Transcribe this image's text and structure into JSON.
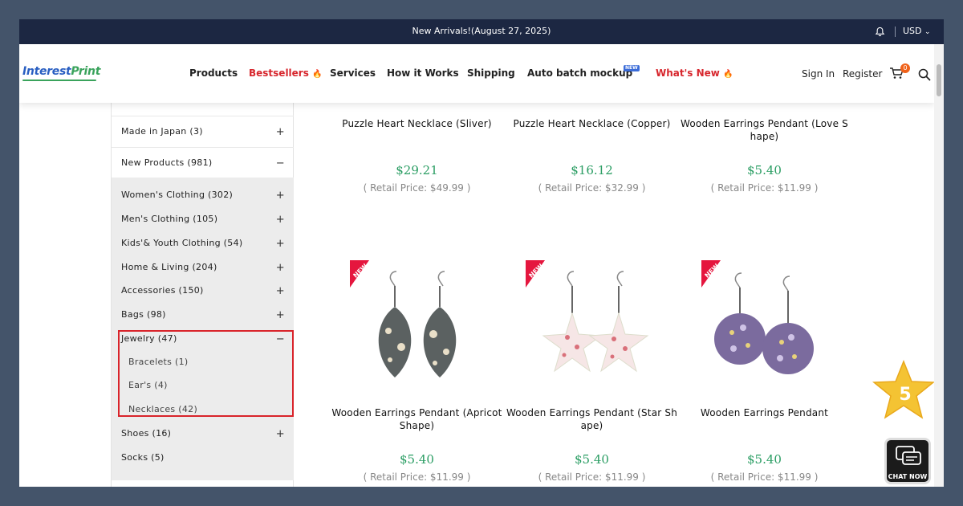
{
  "announcement": {
    "text": "New Arrivals!(August 27, 2025)",
    "currency": "USD"
  },
  "logo": {
    "part1": "Interest",
    "part2": "Print"
  },
  "nav": {
    "products": "Products",
    "bestsellers": "Bestsellers",
    "services": "Services",
    "how_it_works": "How it Works",
    "shipping": "Shipping",
    "auto_batch": "Auto batch mockup",
    "auto_batch_badge": "NEW",
    "whats_new": "What's New",
    "sign_in": "Sign In",
    "register": "Register",
    "cart_count": "0"
  },
  "sidebar": {
    "made_in_japan": "Made in Japan  (3)",
    "new_products": "New Products  (981)",
    "plus": "+",
    "minus": "−",
    "categories": [
      {
        "label": "Women's Clothing  (302)",
        "sign": "+"
      },
      {
        "label": "Men's Clothing  (105)",
        "sign": "+"
      },
      {
        "label": "Kids'& Youth Clothing  (54)",
        "sign": "+"
      },
      {
        "label": "Home & Living  (204)",
        "sign": "+"
      },
      {
        "label": "Accessories  (150)",
        "sign": "+"
      },
      {
        "label": "Bags  (98)",
        "sign": "+"
      },
      {
        "label": "Jewelry  (47)",
        "sign": "−"
      },
      {
        "label": "Shoes  (16)",
        "sign": "+"
      },
      {
        "label": "Socks  (5)",
        "sign": ""
      }
    ],
    "jewelry_sub": [
      {
        "label": "Bracelets  (1)"
      },
      {
        "label": "Ear's  (4)"
      },
      {
        "label": "Necklaces  (42)"
      }
    ]
  },
  "products": [
    {
      "name": "Puzzle Heart Necklace (Sliver)",
      "price": "$29.21",
      "retail": "( Retail Price: $49.99 )"
    },
    {
      "name": "Puzzle Heart Necklace (Copper)",
      "price": "$16.12",
      "retail": "( Retail Price: $32.99 )"
    },
    {
      "name": "Wooden Earrings Pendant  (Love S hape)",
      "price": "$5.40",
      "retail": "( Retail Price: $11.99 )"
    },
    {
      "name": "Wooden Earrings Pendant  (Apricot Shape)",
      "price": "$5.40",
      "retail": "( Retail Price: $11.99 )",
      "badge": "NEW"
    },
    {
      "name": "Wooden Earrings Pendant  (Star Sh ape)",
      "price": "$5.40",
      "retail": "( Retail Price: $11.99 )",
      "badge": "NEW"
    },
    {
      "name": "Wooden Earrings Pendant",
      "price": "$5.40",
      "retail": "( Retail Price: $11.99 )",
      "badge": "NEW"
    }
  ],
  "floating": {
    "star_value": "5",
    "chat_label": "CHAT NOW"
  },
  "colors": {
    "accent_red": "#d7262d",
    "price_green": "#2a9d63",
    "topbar": "#1c2742",
    "backdrop": "#44546a"
  }
}
